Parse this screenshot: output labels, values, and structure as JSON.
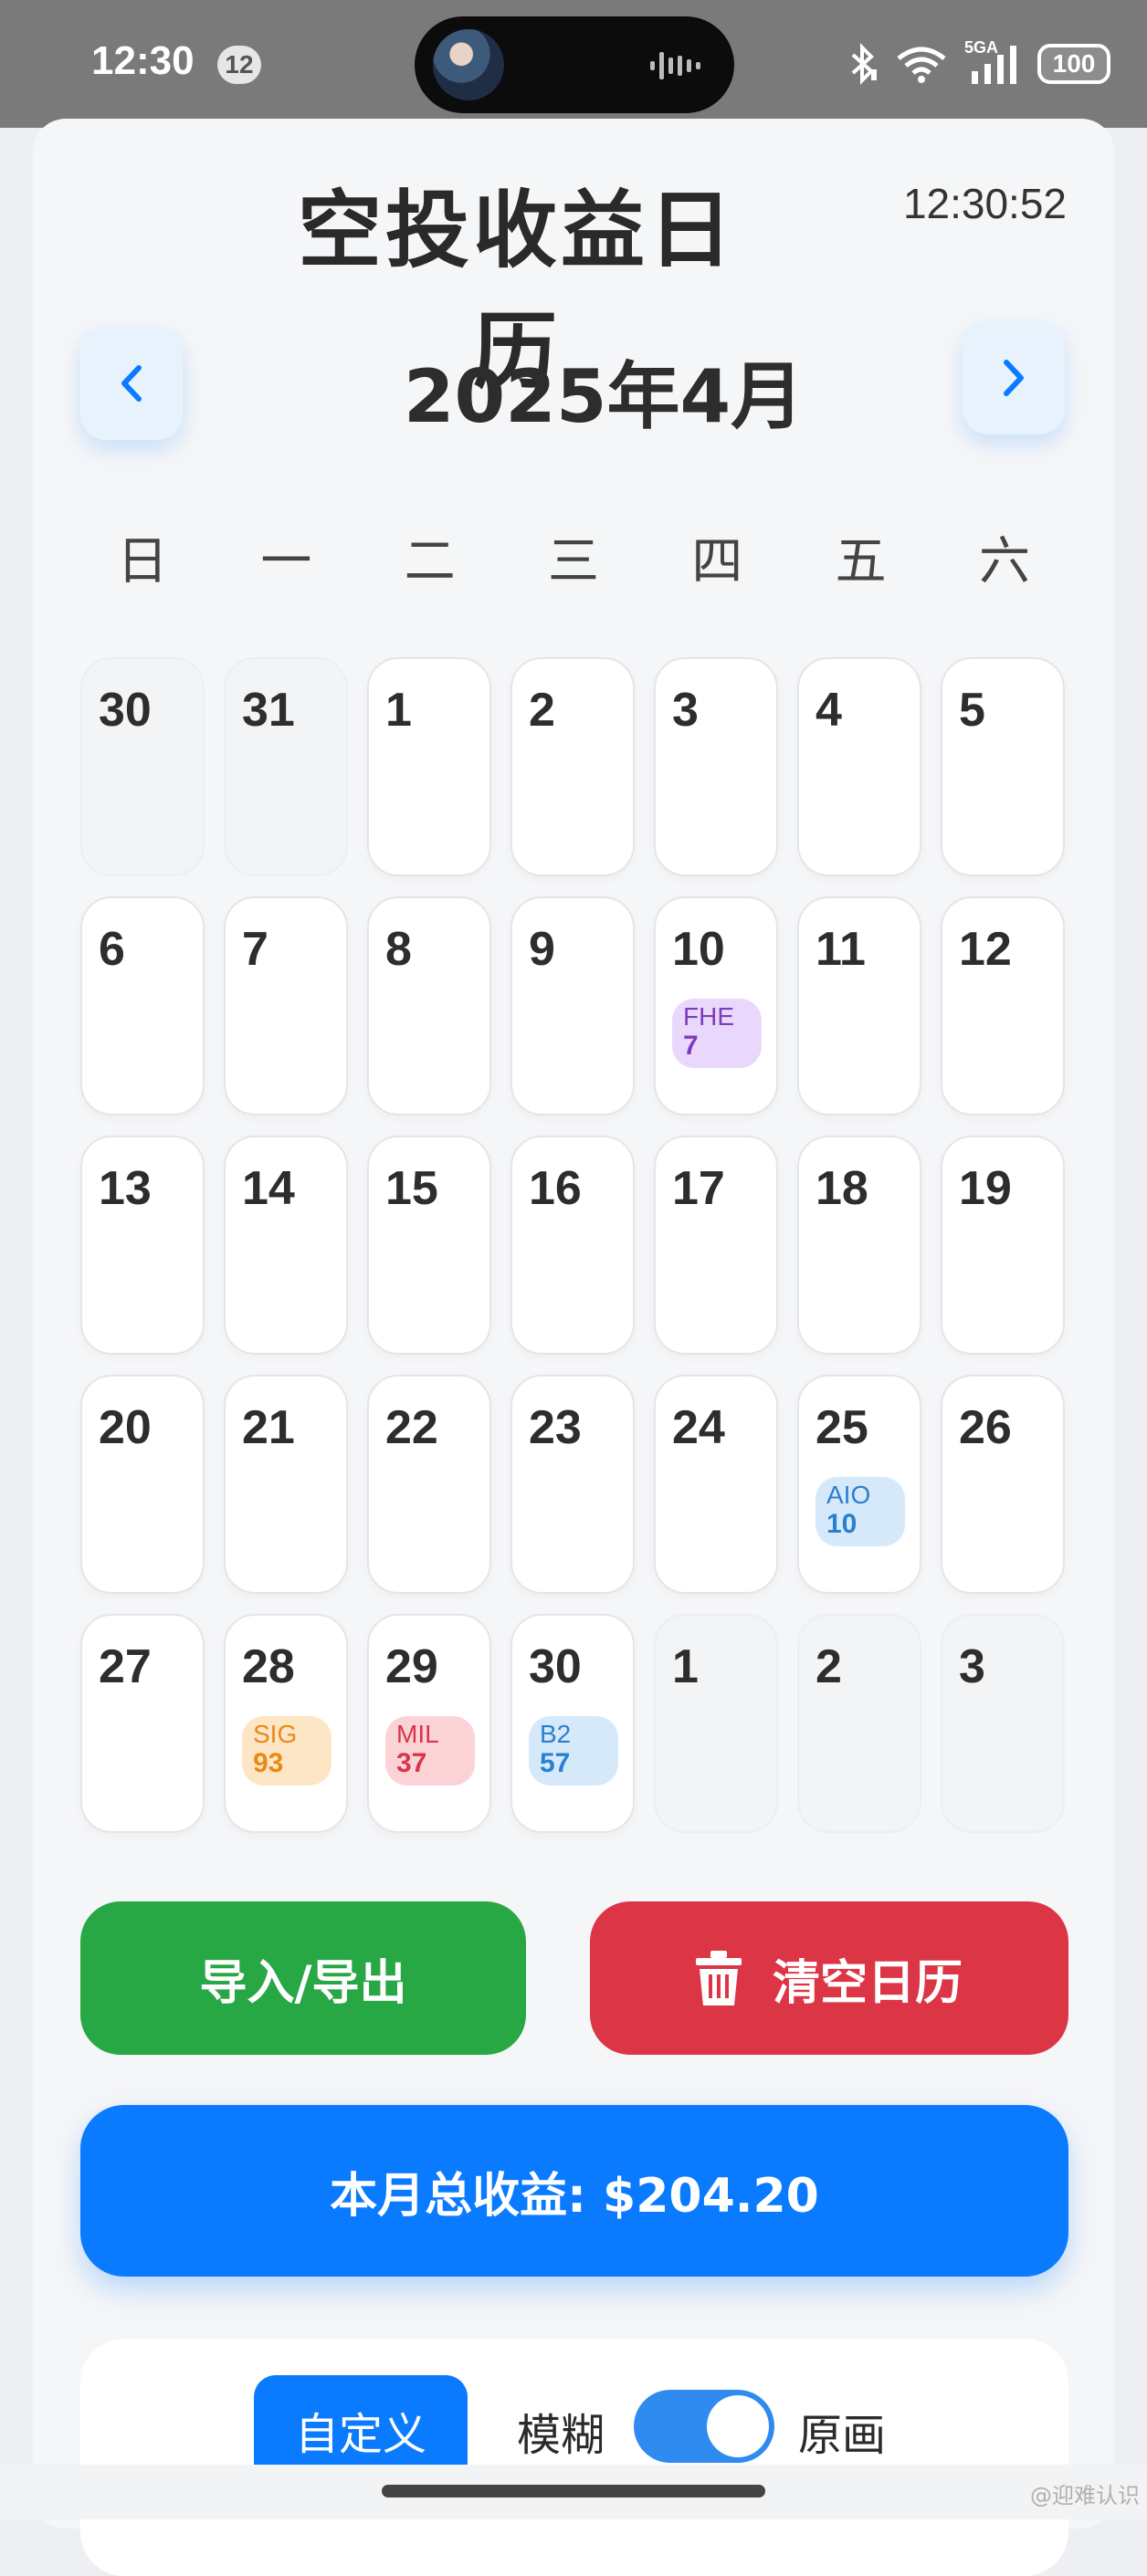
{
  "status_bar": {
    "time": "12:30",
    "notification_count": "12",
    "network": "5GA",
    "battery": "100"
  },
  "header": {
    "title": "空投收益日历",
    "clock": "12:30:52",
    "month_label": "2025年4月"
  },
  "weekdays": [
    "日",
    "一",
    "二",
    "三",
    "四",
    "五",
    "六"
  ],
  "calendar": {
    "weeks": [
      [
        {
          "day": "30",
          "muted": true
        },
        {
          "day": "31",
          "muted": true
        },
        {
          "day": "1"
        },
        {
          "day": "2"
        },
        {
          "day": "3"
        },
        {
          "day": "4"
        },
        {
          "day": "5"
        }
      ],
      [
        {
          "day": "6"
        },
        {
          "day": "7"
        },
        {
          "day": "8"
        },
        {
          "day": "9"
        },
        {
          "day": "10",
          "event": {
            "name": "FHE",
            "amount": "7",
            "bg": "#e9d8fb",
            "color": "#7d3bbd"
          }
        },
        {
          "day": "11"
        },
        {
          "day": "12"
        }
      ],
      [
        {
          "day": "13"
        },
        {
          "day": "14"
        },
        {
          "day": "15"
        },
        {
          "day": "16"
        },
        {
          "day": "17"
        },
        {
          "day": "18"
        },
        {
          "day": "19"
        }
      ],
      [
        {
          "day": "20"
        },
        {
          "day": "21"
        },
        {
          "day": "22"
        },
        {
          "day": "23"
        },
        {
          "day": "24"
        },
        {
          "day": "25",
          "event": {
            "name": "AIO",
            "amount": "10",
            "bg": "#d5e9fb",
            "color": "#2a7fd0"
          }
        },
        {
          "day": "26"
        }
      ],
      [
        {
          "day": "27"
        },
        {
          "day": "28",
          "event": {
            "name": "SIG",
            "amount": "93",
            "bg": "#fde6c6",
            "color": "#e98a14"
          }
        },
        {
          "day": "29",
          "event": {
            "name": "MIL",
            "amount": "37",
            "bg": "#fbd3d6",
            "color": "#d9354a"
          }
        },
        {
          "day": "30",
          "event": {
            "name": "B2",
            "amount": "57",
            "bg": "#d5e9fb",
            "color": "#2a7fd0"
          }
        },
        {
          "day": "1",
          "muted": true
        },
        {
          "day": "2",
          "muted": true
        },
        {
          "day": "3",
          "muted": true
        }
      ]
    ]
  },
  "actions": {
    "import_export_label": "导入/导出",
    "clear_label": "清空日历",
    "monthly_total_label": "本月总收益: $204.20"
  },
  "settings": {
    "custom_label": "自定义",
    "blur_label": "模糊",
    "original_label": "原画",
    "toggle_on": true
  },
  "watermark": "@迎难认识",
  "colors": {
    "primary": "#0a7bff",
    "success": "#28a745",
    "danger": "#dc3545"
  }
}
